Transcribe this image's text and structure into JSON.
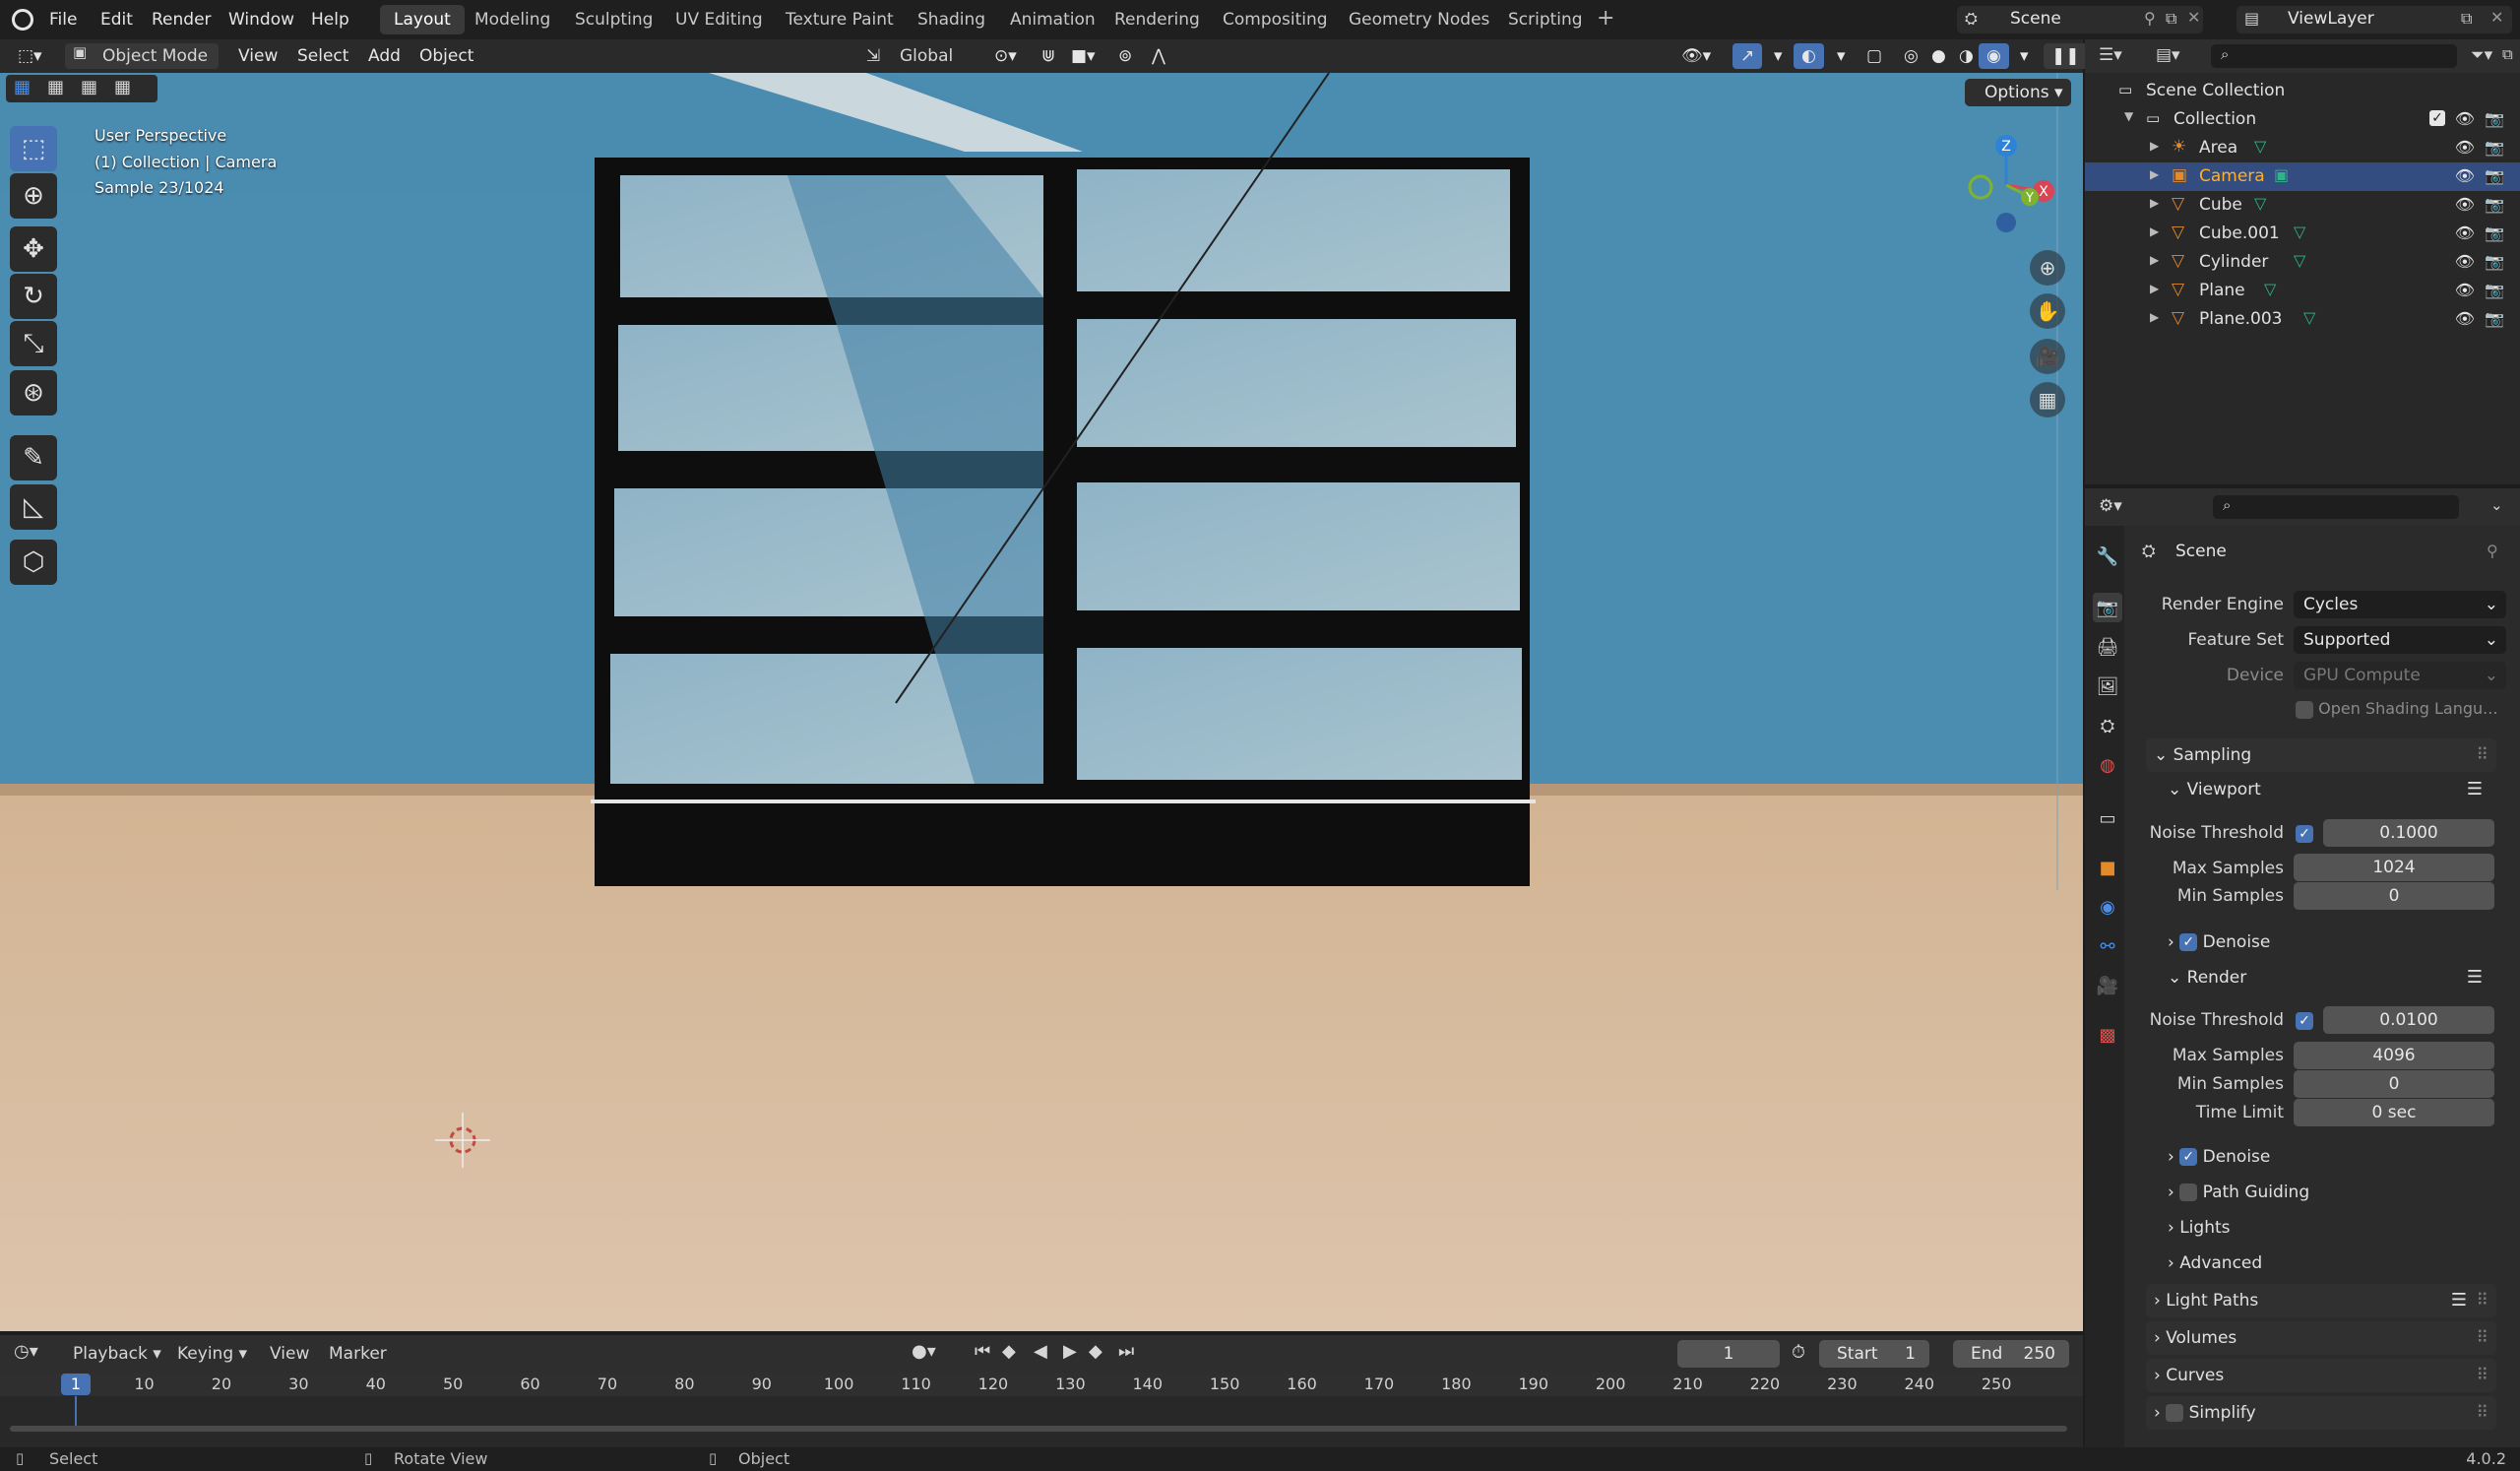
{
  "menus": [
    "File",
    "Edit",
    "Render",
    "Window",
    "Help"
  ],
  "workspaces": [
    "Layout",
    "Modeling",
    "Sculpting",
    "UV Editing",
    "Texture Paint",
    "Shading",
    "Animation",
    "Rendering",
    "Compositing",
    "Geometry Nodes",
    "Scripting"
  ],
  "active_workspace": "Layout",
  "scene_name": "Scene",
  "view_layer": "ViewLayer",
  "viewport_header": {
    "mode": "Object Mode",
    "view": "View",
    "select": "Select",
    "add": "Add",
    "object": "Object",
    "transform": "Global",
    "options": "Options"
  },
  "viewport_overlay": {
    "line1": "User Perspective",
    "line2": "(1) Collection | Camera",
    "line3": "Sample 23/1024"
  },
  "gizmo": {
    "z": "Z",
    "y": "Y",
    "x": "X"
  },
  "outliner": {
    "root": "Scene Collection",
    "collection": "Collection",
    "items": [
      {
        "name": "Area",
        "selected": false
      },
      {
        "name": "Camera",
        "selected": true
      },
      {
        "name": "Cube",
        "selected": false
      },
      {
        "name": "Cube.001",
        "selected": false
      },
      {
        "name": "Cylinder",
        "selected": false
      },
      {
        "name": "Plane",
        "selected": false
      },
      {
        "name": "Plane.003",
        "selected": false
      }
    ]
  },
  "properties": {
    "context": "Scene",
    "render_engine_label": "Render Engine",
    "render_engine": "Cycles",
    "feature_set_label": "Feature Set",
    "feature_set": "Supported",
    "device_label": "Device",
    "device": "GPU Compute",
    "osl": "Open Shading Langu...",
    "sampling": "Sampling",
    "viewport": "Viewport",
    "noise_threshold_label": "Noise Threshold",
    "viewport_noise_threshold": "0.1000",
    "max_samples_label": "Max Samples",
    "viewport_max_samples": "1024",
    "min_samples_label": "Min Samples",
    "viewport_min_samples": "0",
    "denoise": "Denoise",
    "render": "Render",
    "render_noise_threshold": "0.0100",
    "render_max_samples": "4096",
    "render_min_samples": "0",
    "time_limit_label": "Time Limit",
    "time_limit": "0 sec",
    "path_guiding": "Path Guiding",
    "lights": "Lights",
    "advanced": "Advanced",
    "light_paths": "Light Paths",
    "volumes": "Volumes",
    "curves": "Curves",
    "simplify": "Simplify"
  },
  "timeline": {
    "playback": "Playback",
    "keying": "Keying",
    "view": "View",
    "marker": "Marker",
    "current_frame": "1",
    "start_label": "Start",
    "start": "1",
    "end_label": "End",
    "end": "250",
    "ticks": [
      "10",
      "20",
      "30",
      "40",
      "50",
      "60",
      "70",
      "80",
      "90",
      "100",
      "110",
      "120",
      "130",
      "140",
      "150",
      "160",
      "170",
      "180",
      "190",
      "200",
      "210",
      "220",
      "230",
      "240",
      "250"
    ]
  },
  "statusbar": {
    "select": "Select",
    "rotate": "Rotate View",
    "object": "Object",
    "version": "4.0.2"
  }
}
